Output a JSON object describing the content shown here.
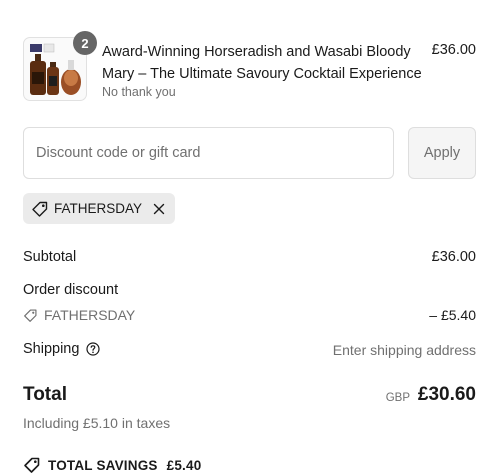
{
  "product": {
    "quantity": "2",
    "title": "Award-Winning Horseradish and Wasabi Bloody Mary – The Ultimate Savoury Cocktail Experience",
    "subtitle": "No thank you",
    "price": "£36.00",
    "image_icon": "bottle-product-image"
  },
  "discount": {
    "placeholder": "Discount code or gift card",
    "value": "",
    "apply_label": "Apply",
    "applied_code": "FATHERSDAY"
  },
  "summary": {
    "subtotal_label": "Subtotal",
    "subtotal_value": "£36.00",
    "order_discount_label": "Order discount",
    "discount_code": "FATHERSDAY",
    "discount_value": "– £5.40",
    "shipping_label": "Shipping",
    "shipping_value": "Enter shipping address",
    "total_label": "Total",
    "currency": "GBP",
    "total_value": "£30.60",
    "taxes_note": "Including £5.10 in taxes",
    "savings_label": "TOTAL SAVINGS",
    "savings_value": "£5.40"
  },
  "colors": {
    "text": "#1a1a1a",
    "muted": "#707070",
    "border": "#dedede",
    "chip_bg": "#ebebeb",
    "badge_bg": "#666666"
  }
}
